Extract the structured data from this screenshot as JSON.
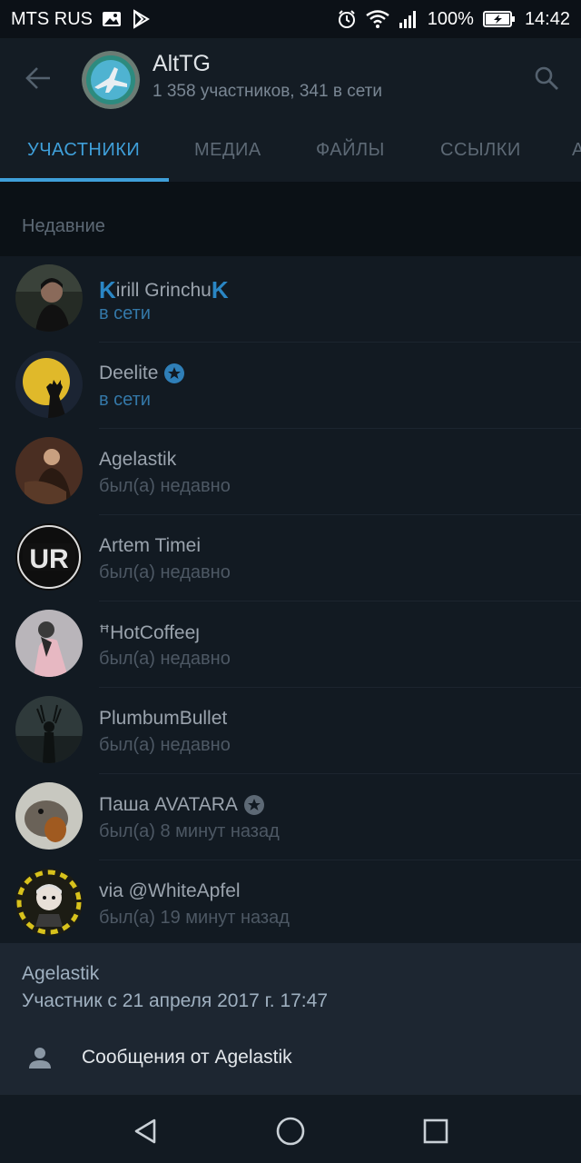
{
  "status_bar": {
    "carrier": "MTS RUS",
    "battery": "100%",
    "time": "14:42",
    "icons": [
      "gallery-icon",
      "play-store-icon",
      "alarm-icon",
      "wifi-icon",
      "signal-icon",
      "battery-charging-icon"
    ]
  },
  "header": {
    "title": "AltTG",
    "subtitle": "1 358 участников, 341 в сети"
  },
  "tabs": [
    {
      "label": "УЧАСТНИКИ",
      "active": true
    },
    {
      "label": "МЕДИА",
      "active": false
    },
    {
      "label": "ФАЙЛЫ",
      "active": false
    },
    {
      "label": "ССЫЛКИ",
      "active": false
    },
    {
      "label": "А",
      "active": false
    }
  ],
  "section": {
    "title": "Недавние"
  },
  "members": [
    {
      "prefix": "K",
      "name": "irill Grinchu",
      "suffix": "K",
      "status": "в сети",
      "online": true,
      "verified": false,
      "avatar_bg": "#2a2f2a"
    },
    {
      "name": "Deelite",
      "status": "в сети",
      "online": true,
      "verified": true,
      "avatar_bg": "#1b2433"
    },
    {
      "name": "Agelastik",
      "status": "был(а) недавно",
      "online": false,
      "verified": false,
      "avatar_bg": "#4a2e22"
    },
    {
      "name": "Artem Timei",
      "status": "был(а) недавно",
      "online": false,
      "verified": false,
      "avatar_bg": "#111111",
      "avatar_text": "UR"
    },
    {
      "name": "ꟸHotCoffeeȷ",
      "status": "был(а) недавно",
      "online": false,
      "verified": false,
      "avatar_bg": "#b9b5ba"
    },
    {
      "name": "PlumbumBullet",
      "status": "был(а) недавно",
      "online": false,
      "verified": false,
      "avatar_bg": "#2f3a3b"
    },
    {
      "name": "Паша AVATARA",
      "status": "был(а) 8 минут назад",
      "online": false,
      "verified": true,
      "avatar_bg": "#8c8878"
    },
    {
      "name": "via @WhiteApfel",
      "status": "был(а) 19 минут назад",
      "online": false,
      "verified": false,
      "avatar_bg": "#1c1c14"
    }
  ],
  "sheet": {
    "name": "Agelastik",
    "since": "Участник с 21 апреля 2017 г. 17:47",
    "action_label": "Сообщения от Agelastik"
  },
  "colors": {
    "accent": "#3f9fd9",
    "online": "#3478a8",
    "background": "#121a22"
  }
}
